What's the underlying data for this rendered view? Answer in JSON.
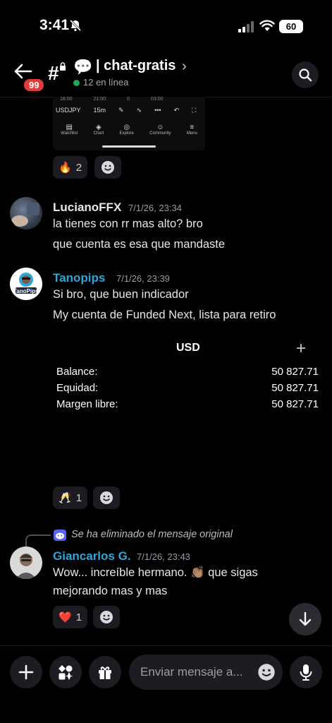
{
  "status_bar": {
    "time": "3:41",
    "battery": "60"
  },
  "header": {
    "unread_badge": "99",
    "channel_name": "| chat-gratis",
    "online": "12 en línea"
  },
  "embed": {
    "times": [
      "18:00",
      "21:00",
      "0",
      "03:00"
    ],
    "symbol": "USDJPY",
    "interval": "15m",
    "nav": [
      "Watchlist",
      "Chart",
      "Explore",
      "Community",
      "Menu"
    ]
  },
  "messages": [
    {
      "reactions": [
        {
          "emoji": "🔥",
          "count": "2"
        }
      ]
    },
    {
      "author": "LucianoFFX",
      "author_color": "#e8e8ec",
      "timestamp": "7/1/26, 23:34",
      "lines": [
        "la tienes con rr mas alto? bro",
        "que cuenta es esa que mandaste"
      ]
    },
    {
      "author": "Tanopips",
      "author_color": "#2ea6d9",
      "timestamp": "7/1/26, 23:39",
      "avatar_label": "TanoPips",
      "lines": [
        "Si bro, que buen indicador",
        "My cuenta de Funded Next, lista para retiro"
      ],
      "card": {
        "currency": "USD",
        "rows": [
          {
            "label": "Balance:",
            "value": "50 827.71"
          },
          {
            "label": "Equidad:",
            "value": "50 827.71"
          },
          {
            "label": "Margen libre:",
            "value": "50 827.71"
          }
        ]
      },
      "reactions": [
        {
          "emoji": "🥂",
          "count": "1"
        }
      ]
    },
    {
      "reply_notice": "Se ha eliminado el mensaje original",
      "author": "Giancarlos G.",
      "author_color": "#2ea6d9",
      "timestamp": "7/1/26, 23:43",
      "lines": [
        "Wow... increíble hermano. 👏🏽 que sigas",
        "mejorando mas y mas"
      ],
      "reactions": [
        {
          "emoji": "❤️",
          "count": "1"
        }
      ]
    }
  ],
  "composer": {
    "placeholder": "Enviar mensaje a..."
  }
}
